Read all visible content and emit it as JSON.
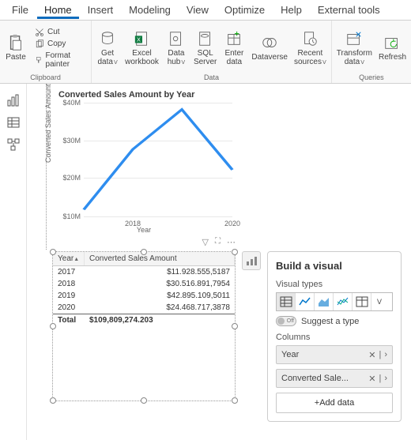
{
  "tabs": [
    "File",
    "Home",
    "Insert",
    "Modeling",
    "View",
    "Optimize",
    "Help",
    "External tools"
  ],
  "active_tab_index": 1,
  "ribbon": {
    "clipboard": {
      "paste": "Paste",
      "cut": "Cut",
      "copy": "Copy",
      "format_painter": "Format painter",
      "group_label": "Clipboard"
    },
    "data": {
      "get_data": "Get\ndata",
      "excel": "Excel\nworkbook",
      "data_hub": "Data\nhub",
      "sql": "SQL\nServer",
      "enter_data": "Enter\ndata",
      "dataverse": "Dataverse",
      "recent": "Recent\nsources",
      "group_label": "Data"
    },
    "queries": {
      "transform": "Transform\ndata",
      "refresh": "Refresh",
      "group_label": "Queries"
    }
  },
  "chart_data": {
    "type": "line",
    "title": "Converted Sales Amount by Year",
    "xlabel": "Year",
    "ylabel": "Converted Sales Amount",
    "categories": [
      "2017",
      "2018",
      "2019",
      "2020"
    ],
    "values": [
      11928555.5187,
      30516891.7954,
      42895109.5011,
      24468717.3878
    ],
    "yticks": [
      "$10M",
      "$20M",
      "$30M",
      "$40M"
    ],
    "xticks": [
      "2018",
      "2020"
    ],
    "ylim": [
      10000000,
      45000000
    ]
  },
  "table": {
    "columns": [
      "Year",
      "Converted Sales Amount"
    ],
    "rows": [
      {
        "year": "2017",
        "amount": "$11.928.555,5187"
      },
      {
        "year": "2018",
        "amount": "$30.516.891,7954"
      },
      {
        "year": "2019",
        "amount": "$42.895.109,5011"
      },
      {
        "year": "2020",
        "amount": "$24.468.717,3878"
      }
    ],
    "total_label": "Total",
    "total_value": "$109,809,274.203"
  },
  "panel": {
    "title": "Build a visual",
    "visual_types_label": "Visual types",
    "suggest_label": "Suggest a type",
    "suggest_toggle_text": "Off",
    "columns_label": "Columns",
    "fields": [
      {
        "label": "Year"
      },
      {
        "label": "Converted Sale..."
      }
    ],
    "add_data": "+Add data"
  }
}
